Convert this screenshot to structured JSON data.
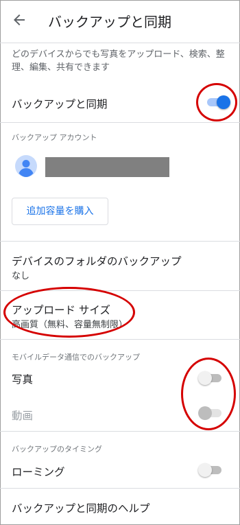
{
  "appbar": {
    "title": "バックアップと同期"
  },
  "description": "どのデバイスからでも写真をアップロード、検索、整理、編集、共有できます",
  "backup_sync": {
    "label": "バックアップと同期",
    "enabled": true
  },
  "account": {
    "section_label": "バックアップ アカウント",
    "buy_storage_label": "追加容量を購入"
  },
  "device_folders": {
    "label": "デバイスのフォルダのバックアップ",
    "value": "なし"
  },
  "upload_size": {
    "label": "アップロード サイズ",
    "value": "高画質（無料、容量無制限）"
  },
  "mobile_data": {
    "section_label": "モバイルデータ通信でのバックアップ",
    "photos": {
      "label": "写真",
      "enabled": false
    },
    "videos": {
      "label": "動画",
      "enabled": false,
      "disabled": true
    }
  },
  "timing": {
    "section_label": "バックアップのタイミング",
    "roaming": {
      "label": "ローミング",
      "enabled": false
    }
  },
  "help": {
    "label": "バックアップと同期のヘルプ"
  },
  "colors": {
    "accent": "#1a73e8",
    "annotation": "#d50000"
  }
}
